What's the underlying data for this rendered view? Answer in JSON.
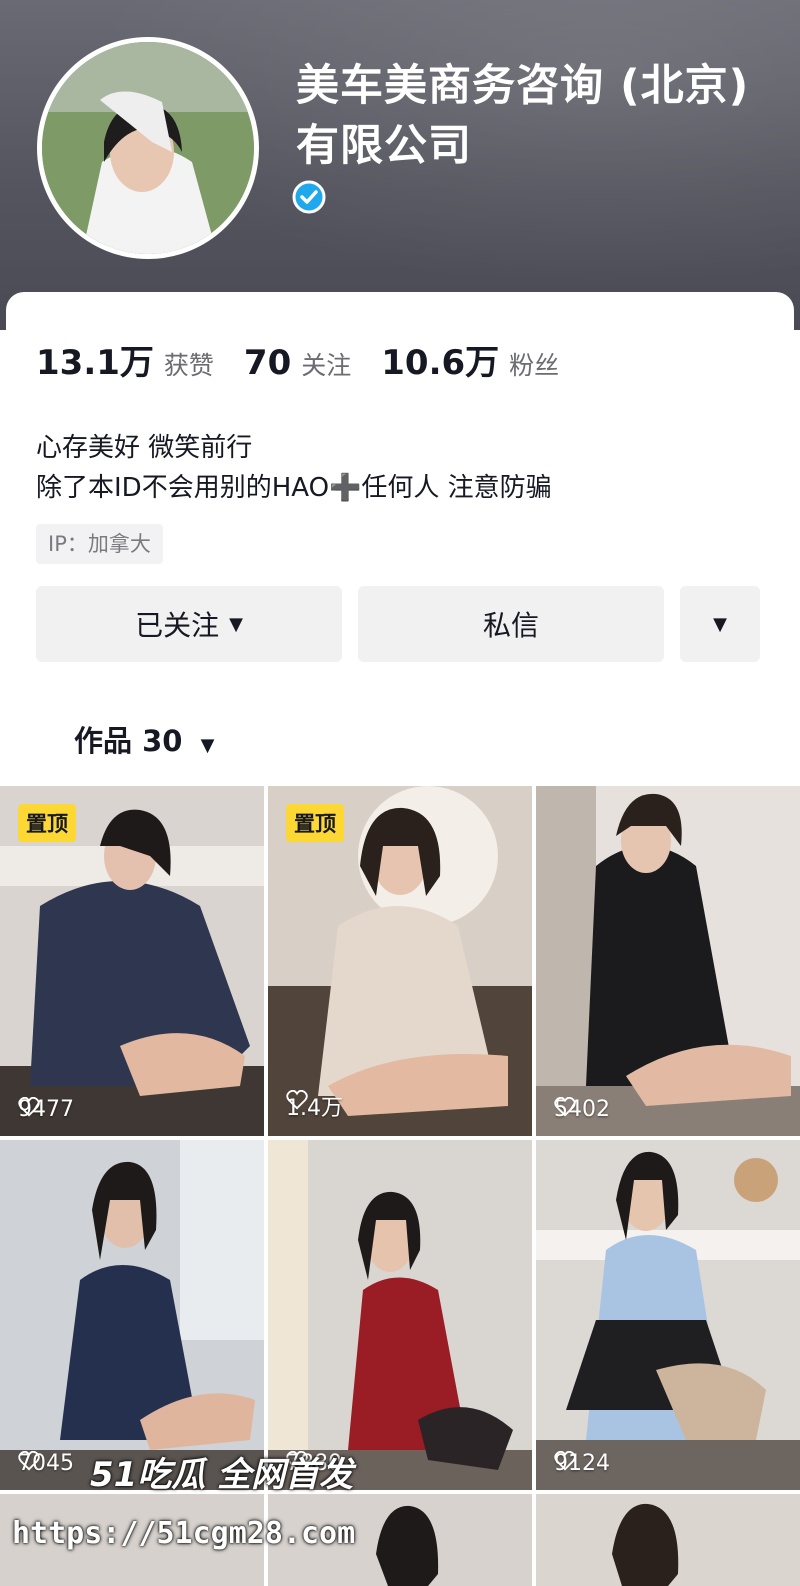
{
  "profile": {
    "name": "美车美商务咨询 (北京) 有限公司",
    "verified": true
  },
  "stats": [
    {
      "value": "13.1万",
      "label": "获赞"
    },
    {
      "value": "70",
      "label": "关注"
    },
    {
      "value": "10.6万",
      "label": "粉丝"
    }
  ],
  "bio": {
    "line1": "心存美好 微笑前行",
    "line2": "除了本ID不会用别的HAO➕任何人 注意防骗"
  },
  "ip": "IP：加拿大",
  "actions": {
    "follow": "已关注",
    "message": "私信"
  },
  "tab": {
    "label": "作品 30"
  },
  "videos": [
    {
      "pinned": "置顶",
      "likes": "9477",
      "palette": "navy"
    },
    {
      "pinned": "置顶",
      "likes": "1.4万",
      "palette": "beige"
    },
    {
      "pinned": "",
      "likes": "5402",
      "palette": "black"
    },
    {
      "pinned": "",
      "likes": "7045",
      "palette": "navy"
    },
    {
      "pinned": "",
      "likes": "7880",
      "palette": "red"
    },
    {
      "pinned": "",
      "likes": "9124",
      "palette": "shirt"
    }
  ],
  "watermark": {
    "line1": "51吃瓜 全网首发",
    "line2": "https://51cgm28.com"
  },
  "colors": {
    "verified_blue": "#20d5ec",
    "pin_yellow": "#fdd835",
    "button_gray": "#f1f1f2"
  }
}
